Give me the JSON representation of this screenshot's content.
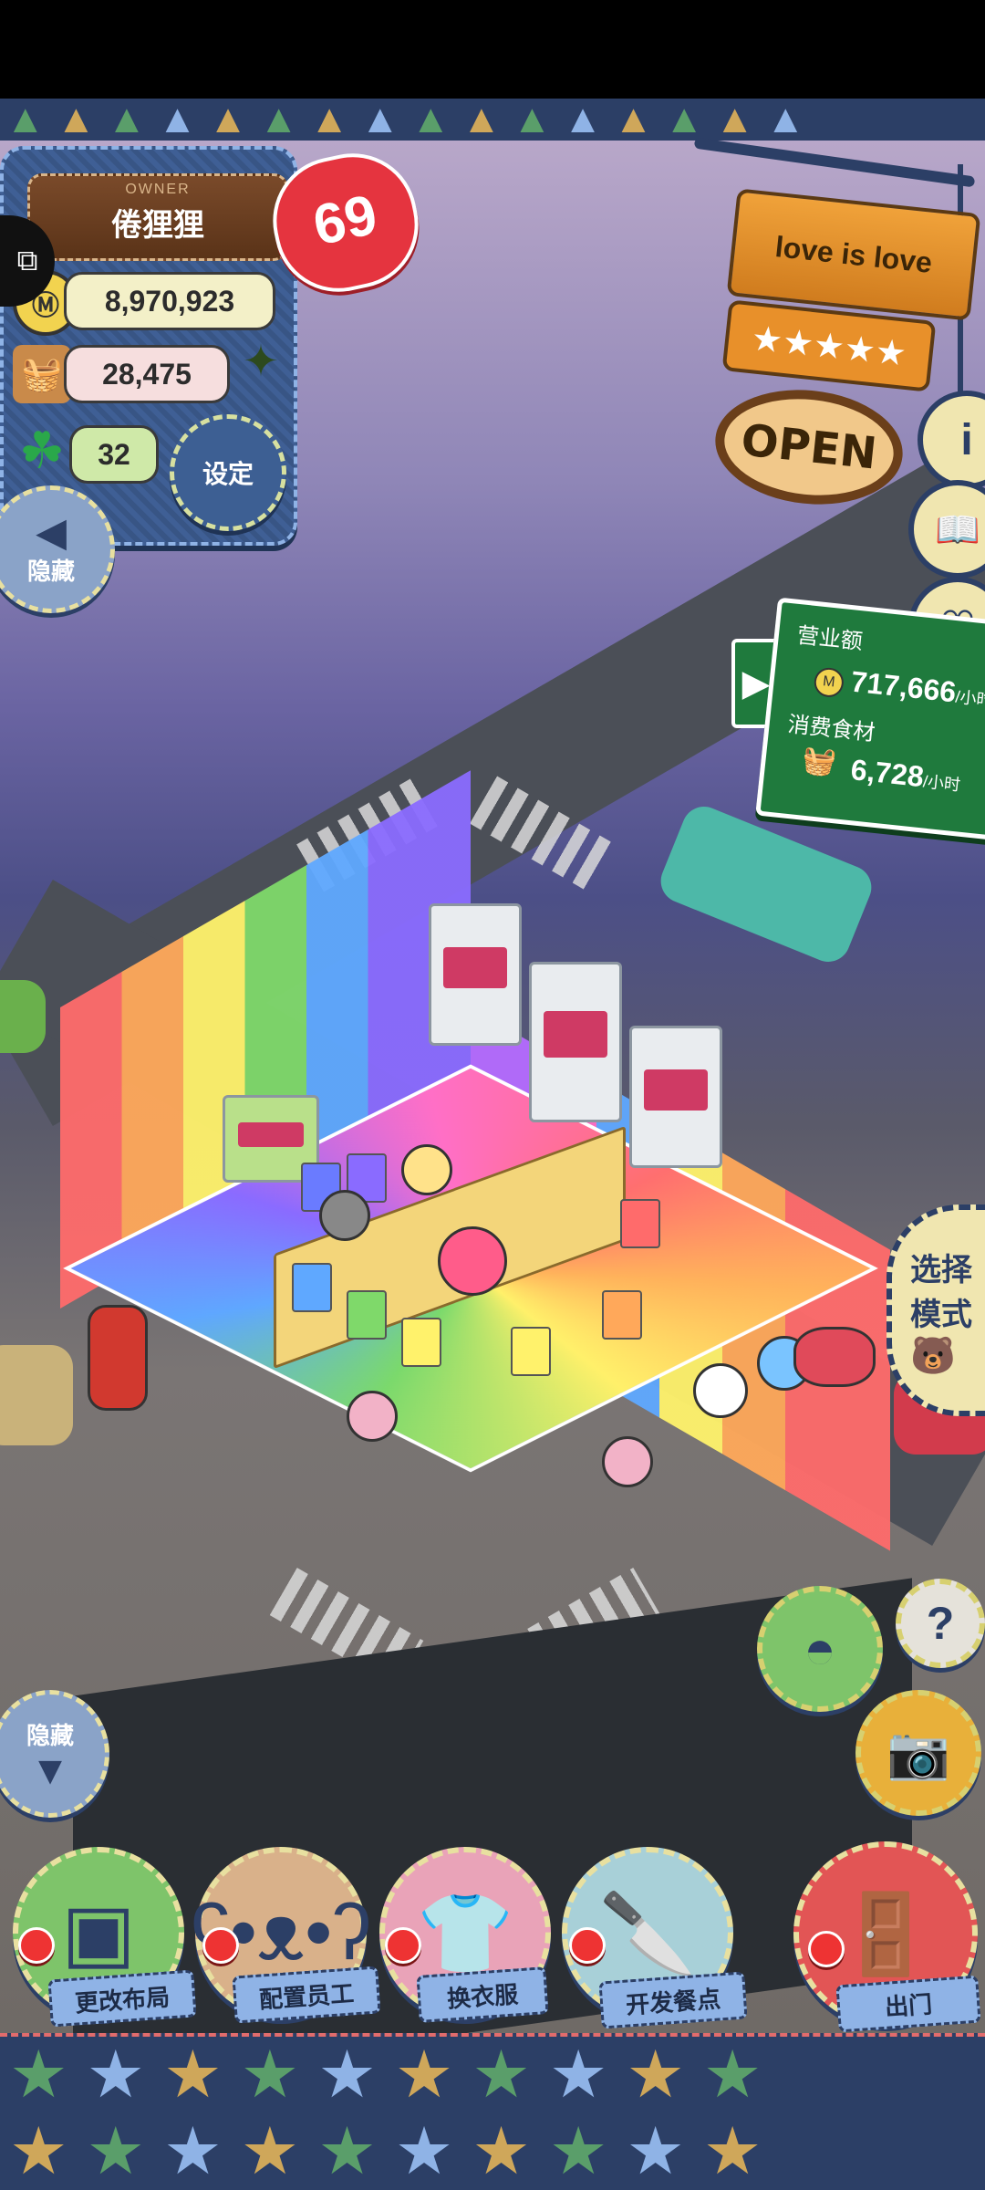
{
  "owner": {
    "label": "OWNER",
    "name": "倦狸狸"
  },
  "hearts": {
    "value": "69"
  },
  "stats": {
    "coins": "8,970,923",
    "ingredients": "28,475",
    "clover": "32"
  },
  "buttons": {
    "settings": "设定",
    "hide_top": "隐藏",
    "hide_bottom": "隐藏"
  },
  "sign": {
    "title": "love is love",
    "stars": "★★★★★",
    "open": "OPEN"
  },
  "revenue": {
    "income_label": "营业额",
    "income_value": "717,666",
    "income_unit": "/小时",
    "consume_label": "消费食材",
    "consume_value": "6,728",
    "consume_unit": "/小时"
  },
  "mode": {
    "label_line1": "选择",
    "label_line2": "模式"
  },
  "actions": [
    {
      "label": "更改布局",
      "color": "#7ec46a"
    },
    {
      "label": "配置员工",
      "color": "#d9b18a"
    },
    {
      "label": "换衣服",
      "color": "#e9a3b8"
    },
    {
      "label": "开发餐点",
      "color": "#a8d0d8"
    },
    {
      "label": "出门",
      "color": "#e25555"
    }
  ],
  "colors": {
    "denim": "#3d5f93",
    "accent_green": "#1f7a3d",
    "heart": "#e5343f"
  }
}
